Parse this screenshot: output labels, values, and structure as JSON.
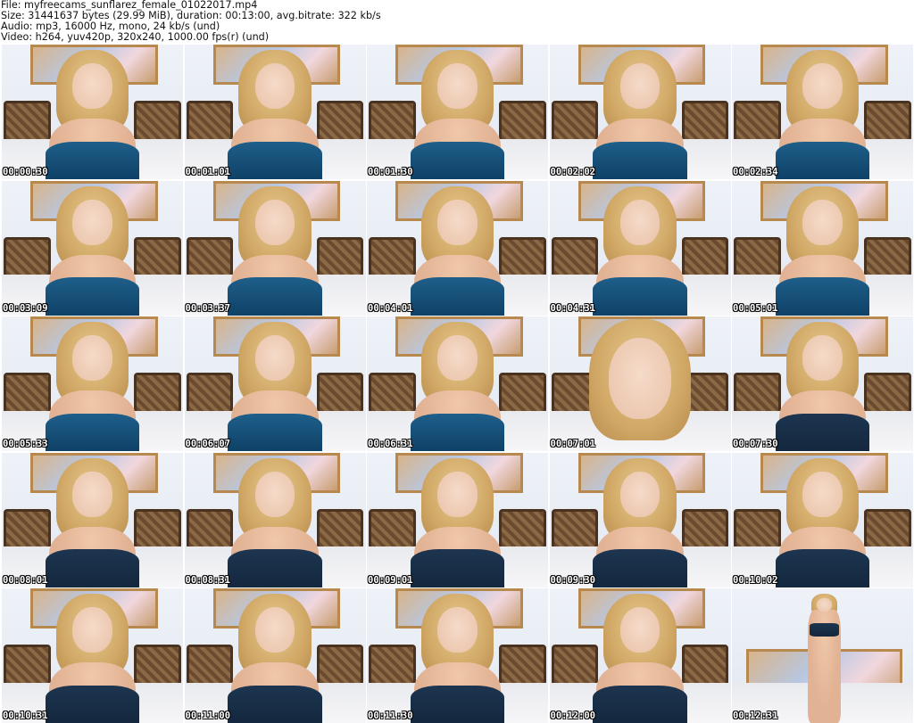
{
  "header": {
    "file": "File: myfreecams_sunflarez_female_01022017.mp4",
    "size": "Size: 31441637 bytes (29.99 MiB), duration: 00:13:00, avg.bitrate: 322 kb/s",
    "audio": "Audio: mp3, 16000 Hz, mono, 24 kb/s (und)",
    "video": "Video: h264, yuv420p, 320x240, 1000.00 fps(r) (und)"
  },
  "thumbnails": [
    {
      "time": "00:00:30",
      "variant": "blue"
    },
    {
      "time": "00:01:01",
      "variant": "blue"
    },
    {
      "time": "00:01:30",
      "variant": "blue"
    },
    {
      "time": "00:02:02",
      "variant": "blue"
    },
    {
      "time": "00:02:34",
      "variant": "blue"
    },
    {
      "time": "00:03:09",
      "variant": "blue"
    },
    {
      "time": "00:03:37",
      "variant": "blue"
    },
    {
      "time": "00:04:01",
      "variant": "blue"
    },
    {
      "time": "00:04:31",
      "variant": "blue"
    },
    {
      "time": "00:05:01",
      "variant": "blue"
    },
    {
      "time": "00:05:33",
      "variant": "blue"
    },
    {
      "time": "00:06:07",
      "variant": "blue"
    },
    {
      "time": "00:06:31",
      "variant": "blue"
    },
    {
      "time": "00:07:01",
      "variant": "close"
    },
    {
      "time": "00:07:30",
      "variant": "navy"
    },
    {
      "time": "00:08:01",
      "variant": "navy"
    },
    {
      "time": "00:08:31",
      "variant": "navy"
    },
    {
      "time": "00:09:01",
      "variant": "navy"
    },
    {
      "time": "00:09:30",
      "variant": "navy"
    },
    {
      "time": "00:10:02",
      "variant": "navy"
    },
    {
      "time": "00:10:31",
      "variant": "navy"
    },
    {
      "time": "00:11:00",
      "variant": "navy"
    },
    {
      "time": "00:11:30",
      "variant": "navy"
    },
    {
      "time": "00:12:00",
      "variant": "navy"
    },
    {
      "time": "00:12:31",
      "variant": "stand"
    }
  ]
}
